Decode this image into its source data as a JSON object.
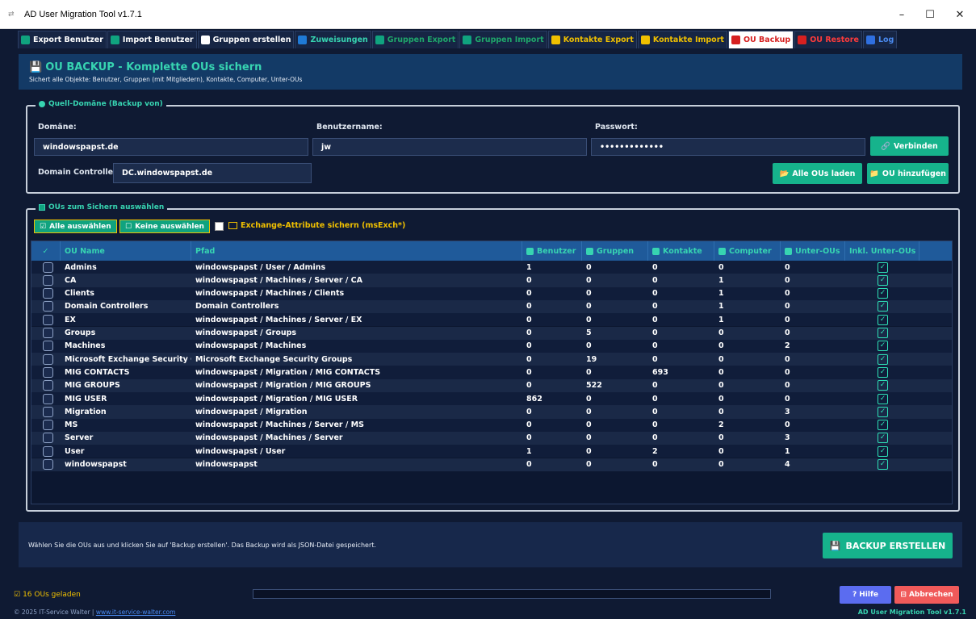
{
  "window": {
    "title": "AD User Migration Tool v1.7.1",
    "minimize": "–",
    "maximize": "☐",
    "close": "✕"
  },
  "tabs": [
    {
      "label": "Export Benutzer",
      "color": "#ffffff",
      "icon_color": "#10a37f",
      "active": false
    },
    {
      "label": "Import Benutzer",
      "color": "#ffffff",
      "icon_color": "#10a37f",
      "active": false
    },
    {
      "label": "Gruppen erstellen",
      "color": "#ffffff",
      "icon_color": "#ffffff",
      "active": false
    },
    {
      "label": "Zuweisungen",
      "color": "#37d4b1",
      "icon_color": "#1f7ad6",
      "active": false
    },
    {
      "label": "Gruppen Export",
      "color": "#1fa86b",
      "icon_color": "#10a37f",
      "active": false
    },
    {
      "label": "Gruppen Import",
      "color": "#1fa86b",
      "icon_color": "#10a37f",
      "active": false
    },
    {
      "label": "Kontakte Export",
      "color": "#f0c000",
      "icon_color": "#f0c000",
      "active": false
    },
    {
      "label": "Kontakte Import",
      "color": "#f0c000",
      "icon_color": "#f0c000",
      "active": false
    },
    {
      "label": "OU Backup",
      "color": "#d62020",
      "icon_color": "#d62020",
      "active": true
    },
    {
      "label": "OU Restore",
      "color": "#ff3b3b",
      "icon_color": "#d62020",
      "active": false
    },
    {
      "label": "Log",
      "color": "#4a8af0",
      "icon_color": "#2f6fe0",
      "active": false
    }
  ],
  "header": {
    "title": "OU BACKUP - Komplette OUs sichern",
    "subtitle": "Sichert alle Objekte: Benutzer, Gruppen (mit Mitgliedern), Kontakte, Computer, Unter-OUs"
  },
  "source": {
    "legend": "Quell-Domäne (Backup von)",
    "domain_label": "Domäne:",
    "domain_value": "windowspapst.de",
    "user_label": "Benutzername:",
    "user_value": "jw",
    "password_label": "Passwort:",
    "password_value": "•••••••••••••",
    "dc_label": "Domain Controller:",
    "dc_value": "DC.windowspapst.de",
    "connect_button": "Verbinden",
    "load_all_button": "Alle OUs laden",
    "add_ou_button": "OU hinzufügen"
  },
  "selection": {
    "legend": "OUs zum Sichern auswählen",
    "select_all": "Alle auswählen",
    "select_none": "Keine auswählen",
    "exchange_label": "Exchange-Attribute sichern (msExch*)"
  },
  "table": {
    "headers": [
      "✓",
      "OU Name",
      "Pfad",
      "Benutzer",
      "Gruppen",
      "Kontakte",
      "Computer",
      "Unter-OUs",
      "Inkl. Unter-OUs"
    ],
    "rows": [
      {
        "name": "Admins",
        "path": "windowspapst / User / Admins",
        "users": "1",
        "groups": "0",
        "contacts": "0",
        "computers": "0",
        "subous": "0"
      },
      {
        "name": "CA",
        "path": "windowspapst / Machines / Server / CA",
        "users": "0",
        "groups": "0",
        "contacts": "0",
        "computers": "1",
        "subous": "0"
      },
      {
        "name": "Clients",
        "path": "windowspapst / Machines / Clients",
        "users": "0",
        "groups": "0",
        "contacts": "0",
        "computers": "1",
        "subous": "0"
      },
      {
        "name": "Domain Controllers",
        "path": "Domain Controllers",
        "users": "0",
        "groups": "0",
        "contacts": "0",
        "computers": "1",
        "subous": "0"
      },
      {
        "name": "EX",
        "path": "windowspapst / Machines / Server / EX",
        "users": "0",
        "groups": "0",
        "contacts": "0",
        "computers": "1",
        "subous": "0"
      },
      {
        "name": "Groups",
        "path": "windowspapst / Groups",
        "users": "0",
        "groups": "5",
        "contacts": "0",
        "computers": "0",
        "subous": "0"
      },
      {
        "name": "Machines",
        "path": "windowspapst / Machines",
        "users": "0",
        "groups": "0",
        "contacts": "0",
        "computers": "0",
        "subous": "2"
      },
      {
        "name": "Microsoft Exchange Security Groups",
        "path": "Microsoft Exchange Security Groups",
        "users": "0",
        "groups": "19",
        "contacts": "0",
        "computers": "0",
        "subous": "0"
      },
      {
        "name": "MIG CONTACTS",
        "path": "windowspapst / Migration / MIG CONTACTS",
        "users": "0",
        "groups": "0",
        "contacts": "693",
        "computers": "0",
        "subous": "0"
      },
      {
        "name": "MIG GROUPS",
        "path": "windowspapst / Migration / MIG GROUPS",
        "users": "0",
        "groups": "522",
        "contacts": "0",
        "computers": "0",
        "subous": "0"
      },
      {
        "name": "MIG USER",
        "path": "windowspapst / Migration / MIG USER",
        "users": "862",
        "groups": "0",
        "contacts": "0",
        "computers": "0",
        "subous": "0"
      },
      {
        "name": "Migration",
        "path": "windowspapst / Migration",
        "users": "0",
        "groups": "0",
        "contacts": "0",
        "computers": "0",
        "subous": "3"
      },
      {
        "name": "MS",
        "path": "windowspapst / Machines / Server / MS",
        "users": "0",
        "groups": "0",
        "contacts": "0",
        "computers": "2",
        "subous": "0"
      },
      {
        "name": "Server",
        "path": "windowspapst / Machines / Server",
        "users": "0",
        "groups": "0",
        "contacts": "0",
        "computers": "0",
        "subous": "3"
      },
      {
        "name": "User",
        "path": "windowspapst / User",
        "users": "1",
        "groups": "0",
        "contacts": "2",
        "computers": "0",
        "subous": "1"
      },
      {
        "name": "windowspapst",
        "path": "windowspapst",
        "users": "0",
        "groups": "0",
        "contacts": "0",
        "computers": "0",
        "subous": "4"
      }
    ]
  },
  "footer": {
    "hint": "Wählen Sie die OUs aus und klicken Sie auf 'Backup erstellen'. Das Backup wird als JSON-Datei gespeichert.",
    "backup_button": "BACKUP ERSTELLEN"
  },
  "status": {
    "loaded": "16 OUs geladen",
    "copyright": "© 2025 IT-Service Walter | ",
    "link": "www.it-service-walter.com",
    "help_button": "Hilfe",
    "cancel_button": "Abbrechen",
    "version": "AD User Migration Tool v1.7.1"
  }
}
